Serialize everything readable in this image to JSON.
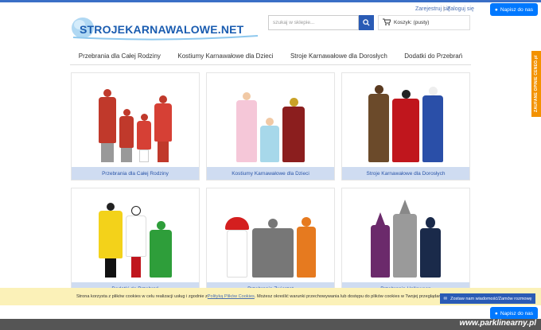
{
  "header": {
    "logo_text": "STROJEKARNAWALOWE.NET",
    "register": "Zarejestruj się",
    "login": "Zaloguj się",
    "search_placeholder": "szukaj w sklepie...",
    "cart": "Koszyk: (pusty)",
    "chat": "Napisz do nas"
  },
  "nav": [
    "Przebrania dla Całej Rodziny",
    "Kostiumy Karnawałowe dla Dzieci",
    "Stroje Karnawałowe dla Dorosłych",
    "Dodatki do Przebrań"
  ],
  "side_tab": "ZAUFANE OPINIE CENEO.pl",
  "cards": [
    {
      "caption": "Przebrania dla Całej Rodziny"
    },
    {
      "caption": "Kostiumy Karnawałowe dla Dzieci"
    },
    {
      "caption": "Stroje Karnawałowe dla Dorosłych"
    },
    {
      "caption": "Dodatki do Przebrań"
    },
    {
      "caption": "Przebrania Zwierząt"
    },
    {
      "caption": "Przebrania Halloween"
    }
  ],
  "cookie": {
    "text_a": "Strona korzysta z plików cookies w celu realizacji usług i zgodnie z ",
    "link": "Polityką Plików Cookies",
    "text_b": ". Możesz określić warunki przechowywania lub dostępu do plików cookies w Twojej przeglądarce.",
    "button": "Zostaw nam wiadomość/Zamów rozmowę"
  },
  "chat_bottom": "Napisz do nas",
  "watermark": "www.parklinearny.pl",
  "colors": {
    "accent": "#2a5bb5",
    "cookie_bg": "#fbf1b8",
    "side_tab": "#f39200",
    "messenger": "#0078ff"
  }
}
